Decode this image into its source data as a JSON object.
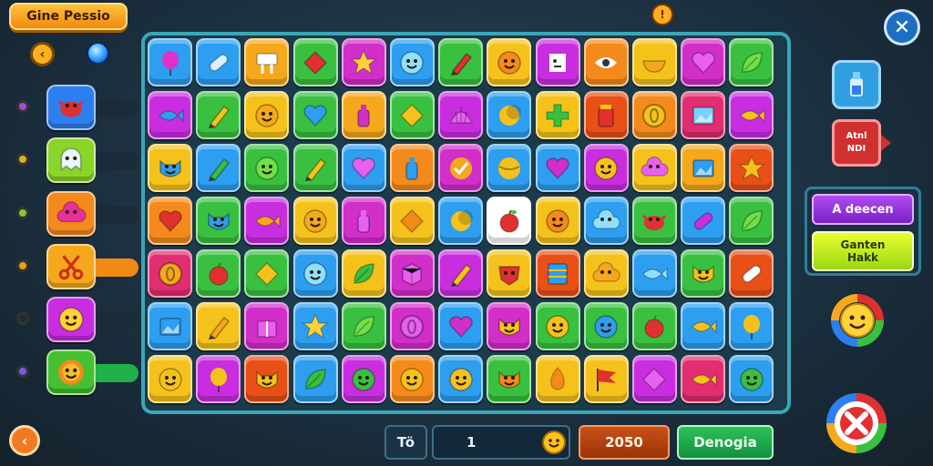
{
  "header": {
    "title": "Gine Pessio"
  },
  "close_label": "✕",
  "nav": {
    "back_glyph": "‹"
  },
  "side_panel": {
    "items": [
      {
        "tile_color": "#2d7ff0",
        "icon": "crab-icon",
        "icon_color": "#e03030",
        "dot_color": "#a24cd6",
        "bar_color": "#1c2b3a"
      },
      {
        "tile_color": "#8bd42a",
        "icon": "ghost-icon",
        "icon_color": "#e8f6ff",
        "dot_color": "#e0b020",
        "bar_color": "#1c2b3a"
      },
      {
        "tile_color": "#f58a1c",
        "icon": "cloud-icon",
        "icon_color": "#e8309a",
        "dot_color": "#88c830",
        "bar_color": "#1c2b3a"
      },
      {
        "tile_color": "#f5a81c",
        "icon": "scissors-icon",
        "icon_color": "#d03018",
        "dot_color": "#f0a010",
        "bar_color": "#f08a14"
      },
      {
        "tile_color": "#c82ee0",
        "icon": "smiley-icon",
        "icon_color": "#ffd23a",
        "dot_color": "#1c2b3a",
        "bar_color": "#1c2b3a"
      },
      {
        "tile_color": "#44c030",
        "icon": "lion-icon",
        "icon_color": "#f5c030",
        "dot_color": "#7a5ae0",
        "bar_color": "#22b04a"
      }
    ]
  },
  "board": {
    "rows": [
      [
        [
          "#2d9ef0",
          "balloon",
          "#e030c8"
        ],
        [
          "#2d9ef0",
          "pill",
          "#d8f0ff"
        ],
        [
          "#f5a81c",
          "sign",
          "#ffffff"
        ],
        [
          "#3ac040",
          "diamond",
          "#e03030"
        ],
        [
          "#d22ec8",
          "star",
          "#ffd23a"
        ],
        [
          "#2d9ef0",
          "smiley",
          "#8fe0ff"
        ],
        [
          "#3ac040",
          "crayon",
          "#e03030"
        ],
        [
          "#f5c21c",
          "smiley",
          "#f58a1c"
        ],
        [
          "#c82ee0",
          "face",
          "#ffffff"
        ],
        [
          "#f58a1c",
          "eye",
          "#ffffff"
        ],
        [
          "#f5c21c",
          "bowl",
          "#f5a81c"
        ],
        [
          "#d22ec8",
          "heart",
          "#e860f0"
        ],
        [
          "#3ac040",
          "leaf",
          "#6ee04a"
        ]
      ],
      [
        [
          "#c82ee0",
          "fish",
          "#2d9ef0"
        ],
        [
          "#3ac040",
          "crayon",
          "#f5c21c"
        ],
        [
          "#f5c21c",
          "smiley",
          "#f5a81c"
        ],
        [
          "#3ac040",
          "heart",
          "#2d9ef0"
        ],
        [
          "#f5a81c",
          "bottle",
          "#d22ec8"
        ],
        [
          "#3ac040",
          "diamond",
          "#f5c21c"
        ],
        [
          "#c82ee0",
          "shell",
          "#e860f0"
        ],
        [
          "#2d9ef0",
          "moon",
          "#f5c21c"
        ],
        [
          "#f5c21c",
          "cross",
          "#3ac040"
        ],
        [
          "#e85018",
          "jar",
          "#e03030"
        ],
        [
          "#f58a1c",
          "coin",
          "#f5c21c"
        ],
        [
          "#e02e70",
          "picture",
          "#7ad0ff"
        ],
        [
          "#c82ee0",
          "fish",
          "#f5c21c"
        ]
      ],
      [
        [
          "#f5c21c",
          "cat",
          "#2d9ef0"
        ],
        [
          "#2d9ef0",
          "crayon",
          "#3ac040"
        ],
        [
          "#3ac040",
          "smiley",
          "#6ee04a"
        ],
        [
          "#3ac040",
          "crayon",
          "#f5c21c"
        ],
        [
          "#2d9ef0",
          "heart",
          "#e860f0"
        ],
        [
          "#f58a1c",
          "bottle",
          "#2d9ef0"
        ],
        [
          "#d22ec8",
          "check",
          "#f5a81c"
        ],
        [
          "#2d9ef0",
          "ball",
          "#f5c21c"
        ],
        [
          "#2d9ef0",
          "heart",
          "#d22ec8"
        ],
        [
          "#c82ee0",
          "smiley",
          "#f5c21c"
        ],
        [
          "#f5c21c",
          "cloud",
          "#e860f0"
        ],
        [
          "#f5a81c",
          "picture",
          "#2d9ef0"
        ],
        [
          "#e85018",
          "star",
          "#f5c21c"
        ]
      ],
      [
        [
          "#f58a1c",
          "heart",
          "#e03030"
        ],
        [
          "#3ac040",
          "cat",
          "#2d9ef0"
        ],
        [
          "#c82ee0",
          "fish",
          "#f5a81c"
        ],
        [
          "#f5c21c",
          "smiley",
          "#f5a81c"
        ],
        [
          "#d22ec8",
          "bottle",
          "#e860f0"
        ],
        [
          "#f5c21c",
          "diamond",
          "#f58a1c"
        ],
        [
          "#2d9ef0",
          "moon",
          "#f5c21c"
        ],
        [
          "#ffffff",
          "apple",
          "#e03030"
        ],
        [
          "#f5c21c",
          "smiley",
          "#f58a1c"
        ],
        [
          "#2d9ef0",
          "cloud",
          "#8fe0ff"
        ],
        [
          "#3ac040",
          "crab",
          "#e03030"
        ],
        [
          "#2d9ef0",
          "pill",
          "#c82ee0"
        ],
        [
          "#3ac040",
          "leaf",
          "#6ee04a"
        ]
      ],
      [
        [
          "#e02e70",
          "coin",
          "#f5a81c"
        ],
        [
          "#3ac040",
          "apple",
          "#e03030"
        ],
        [
          "#3ac040",
          "diamond",
          "#f5c21c"
        ],
        [
          "#2d9ef0",
          "smiley",
          "#8fe0ff"
        ],
        [
          "#f5c21c",
          "leaf",
          "#3ac040"
        ],
        [
          "#d22ec8",
          "box",
          "#e860f0"
        ],
        [
          "#c82ee0",
          "crayon",
          "#f5c21c"
        ],
        [
          "#f5c21c",
          "mask",
          "#e03030"
        ],
        [
          "#e85018",
          "book",
          "#2d9ef0"
        ],
        [
          "#f5c21c",
          "cloud",
          "#f5a81c"
        ],
        [
          "#2d9ef0",
          "fish",
          "#8fe0ff"
        ],
        [
          "#3ac040",
          "cat",
          "#f5c21c"
        ],
        [
          "#e85018",
          "pill",
          "#ffffff"
        ]
      ],
      [
        [
          "#2d9ef0",
          "picture",
          "#2d9ef0"
        ],
        [
          "#f5c21c",
          "crayon",
          "#f5a81c"
        ],
        [
          "#d22ec8",
          "gift",
          "#e860f0"
        ],
        [
          "#2d9ef0",
          "star",
          "#ffd23a"
        ],
        [
          "#3ac040",
          "leaf",
          "#6ee04a"
        ],
        [
          "#d22ec8",
          "coin",
          "#e860f0"
        ],
        [
          "#2d9ef0",
          "heart",
          "#d22ec8"
        ],
        [
          "#d22ec8",
          "cat",
          "#f5c21c"
        ],
        [
          "#3ac040",
          "smiley",
          "#f5c21c"
        ],
        [
          "#3ac040",
          "smiley",
          "#2d9ef0"
        ],
        [
          "#3ac040",
          "apple",
          "#e03030"
        ],
        [
          "#2d9ef0",
          "fish",
          "#f5c21c"
        ],
        [
          "#2d9ef0",
          "balloon",
          "#f5c21c"
        ]
      ],
      [
        [
          "#f5c21c",
          "smiley",
          "#f5c21c"
        ],
        [
          "#c82ee0",
          "balloon",
          "#f5c21c"
        ],
        [
          "#e85018",
          "cat",
          "#f5c21c"
        ],
        [
          "#2d9ef0",
          "leaf",
          "#3ac040"
        ],
        [
          "#c82ee0",
          "smiley",
          "#3ac040"
        ],
        [
          "#f58a1c",
          "smiley",
          "#f5c21c"
        ],
        [
          "#2d9ef0",
          "smiley",
          "#f5c21c"
        ],
        [
          "#3ac040",
          "cat",
          "#f58a1c"
        ],
        [
          "#f5c21c",
          "fire",
          "#f58a1c"
        ],
        [
          "#f5c21c",
          "flag",
          "#e03030"
        ],
        [
          "#c82ee0",
          "diamond",
          "#e860f0"
        ],
        [
          "#e02e70",
          "fish",
          "#f5c21c"
        ],
        [
          "#2d9ef0",
          "smiley",
          "#3ac040"
        ]
      ]
    ]
  },
  "right_panel": {
    "red_label_line1": "Atnl",
    "red_label_line2": "NDI",
    "option1": "A deecen",
    "option2_line1": "Ganten",
    "option2_line2": "Hakk"
  },
  "bottom_bar": {
    "prefix": "Tö",
    "input_value": "1",
    "score": "2050",
    "button": "Denogia"
  }
}
